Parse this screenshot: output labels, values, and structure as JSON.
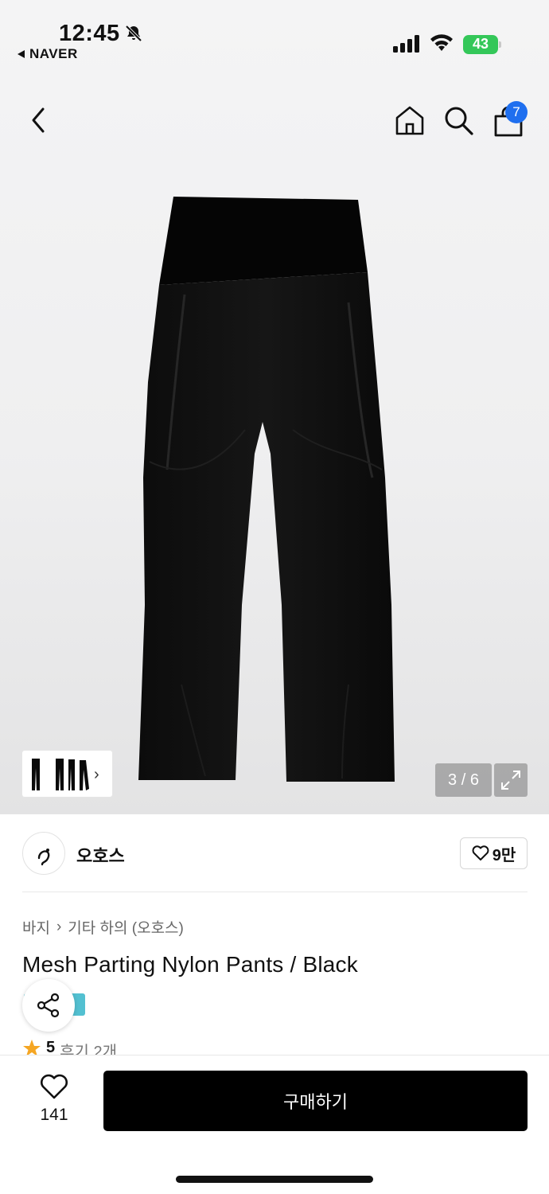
{
  "status_bar": {
    "time": "12:45",
    "back_app_label": "NAVER",
    "battery_level": "43",
    "battery_color": "#34c759"
  },
  "nav": {
    "back_icon": "chevron-left-icon",
    "home_icon": "home-icon",
    "search_icon": "search-icon",
    "bag_icon": "shopping-bag-icon",
    "cart_count": "7",
    "badge_color": "#1f6fef"
  },
  "gallery": {
    "page_counter": "3 / 6",
    "current_index": 3,
    "total": 6,
    "image_icon": "black-pants-image"
  },
  "brand": {
    "name": "오호스",
    "like_count": "9만"
  },
  "product": {
    "breadcrumb": [
      "바지",
      "기타 하의 (오호스)"
    ],
    "title": "Mesh Parting Nylon Pants / Black",
    "rating": "5",
    "reviews": "후기 2개",
    "tag_color": "#53c0d1"
  },
  "bottom_bar": {
    "wish_count": "141",
    "buy_label": "구매하기"
  }
}
